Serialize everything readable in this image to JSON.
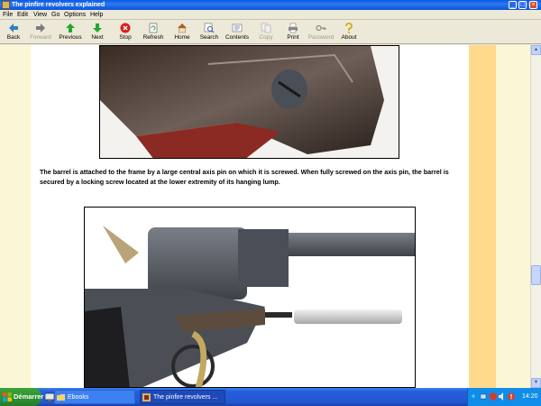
{
  "window": {
    "title": "The pinfire revolvers explained"
  },
  "menu": [
    "File",
    "Edit",
    "View",
    "Go",
    "Options",
    "Help"
  ],
  "toolbar": {
    "buttons": [
      {
        "label": "Back",
        "icon": "back-arrow-icon",
        "enabled": true
      },
      {
        "label": "Forward",
        "icon": "forward-arrow-icon",
        "enabled": false
      },
      {
        "label": "Previous",
        "icon": "up-arrow-icon",
        "enabled": true
      },
      {
        "label": "Next",
        "icon": "down-arrow-icon",
        "enabled": true
      },
      {
        "label": "Stop",
        "icon": "stop-icon",
        "enabled": true
      },
      {
        "label": "Refresh",
        "icon": "refresh-icon",
        "enabled": true
      },
      {
        "label": "Home",
        "icon": "home-icon",
        "enabled": true
      },
      {
        "label": "Search",
        "icon": "search-icon",
        "enabled": true
      },
      {
        "label": "Contents",
        "icon": "contents-icon",
        "enabled": true
      },
      {
        "label": "Copy",
        "icon": "copy-icon",
        "enabled": false
      },
      {
        "label": "Print",
        "icon": "print-icon",
        "enabled": true
      },
      {
        "label": "Password",
        "icon": "key-icon",
        "enabled": false
      },
      {
        "label": "About",
        "icon": "about-icon",
        "enabled": true
      }
    ]
  },
  "page": {
    "caption": "The barrel is attached to the frame by a large central axis pin on which it is screwed. When fully screwed on the axis pin, the barrel is secured by a locking screw located at the lower extremity of its hanging lump."
  },
  "taskbar": {
    "start_label": "Démarrer",
    "tasks": [
      {
        "label": "Ebooks",
        "active": false
      },
      {
        "label": "The pinfire revolvers ...",
        "active": true
      }
    ],
    "clock": "14:20"
  },
  "colors": {
    "page_background": "#fbf6d6",
    "accent_band": "#ffd98c",
    "titlebar": "#0a5be4",
    "taskbar": "#245edb"
  }
}
